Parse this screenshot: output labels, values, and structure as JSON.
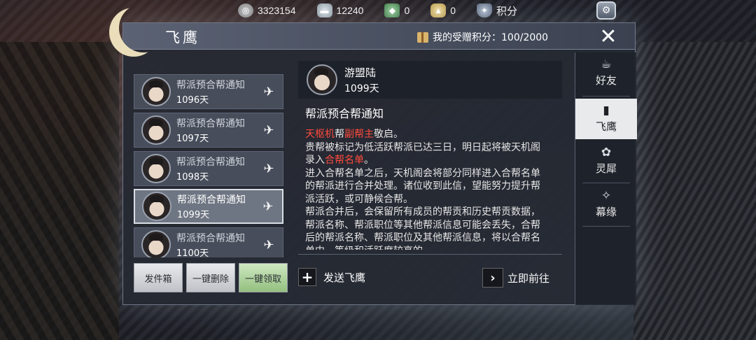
{
  "topbar": {
    "resources": [
      {
        "icon": "coin-icon",
        "value": "3323154"
      },
      {
        "icon": "silver-ingot-icon",
        "value": "12240"
      },
      {
        "icon": "jade-icon",
        "value": "0"
      },
      {
        "icon": "gold-ingot-icon",
        "value": "0"
      }
    ],
    "points_label": "积分"
  },
  "panel": {
    "title": "飞鹰",
    "received_points": "我的受赠积分：100/2000",
    "close_glyph": "✕"
  },
  "mail_list": [
    {
      "title": "帮派预合帮通知",
      "days": "1096天",
      "selected": false
    },
    {
      "title": "帮派预合帮通知",
      "days": "1097天",
      "selected": false
    },
    {
      "title": "帮派预合帮通知",
      "days": "1098天",
      "selected": false
    },
    {
      "title": "帮派预合帮通知",
      "days": "1099天",
      "selected": true
    },
    {
      "title": "帮派预合帮通知",
      "days": "1100天",
      "selected": false
    }
  ],
  "buttons": {
    "outbox": "发件箱",
    "delete_all": "一键删除",
    "claim_all": "一键领取"
  },
  "sender": {
    "name": "游盟陆",
    "days": "1099天"
  },
  "letter": {
    "title": "帮派预合帮通知",
    "line1_a": "天枢机",
    "line1_b": "帮",
    "line1_c": "副帮主",
    "line1_d": "敬启。",
    "para1_a": "贵帮被标记为低活跃帮派已达三日，明日起将被天机阁录入",
    "para1_b": "合帮名单",
    "para1_c": "。",
    "para2": "进入合帮名单之后，天机阁会将部分同样进入合帮名单的帮派进行合并处理。诸位收到此信，望能努力提升帮派活跃，或可静候合帮。",
    "para3": "帮派合并后，会保留所有成员的帮贡和历史帮贡数据，帮派名称、帮派职位等其他帮派信息可能会丢失，合帮后的帮派名称、帮派职位及其他帮派信息，将以合帮名单中，等级和活跃度较高的"
  },
  "actions": {
    "send": "发送飞鹰",
    "go": "立即前往"
  },
  "tabs": [
    {
      "icon": "teapot-icon",
      "glyph": "☕",
      "label": "好友",
      "active": false
    },
    {
      "icon": "scroll-icon",
      "glyph": "📜",
      "label": "飞鹰",
      "active": true
    },
    {
      "icon": "rhino-horn-icon",
      "glyph": "✿",
      "label": "灵犀",
      "active": false
    },
    {
      "icon": "paper-crane-icon",
      "glyph": "✧",
      "label": "幕缘",
      "active": false
    }
  ]
}
